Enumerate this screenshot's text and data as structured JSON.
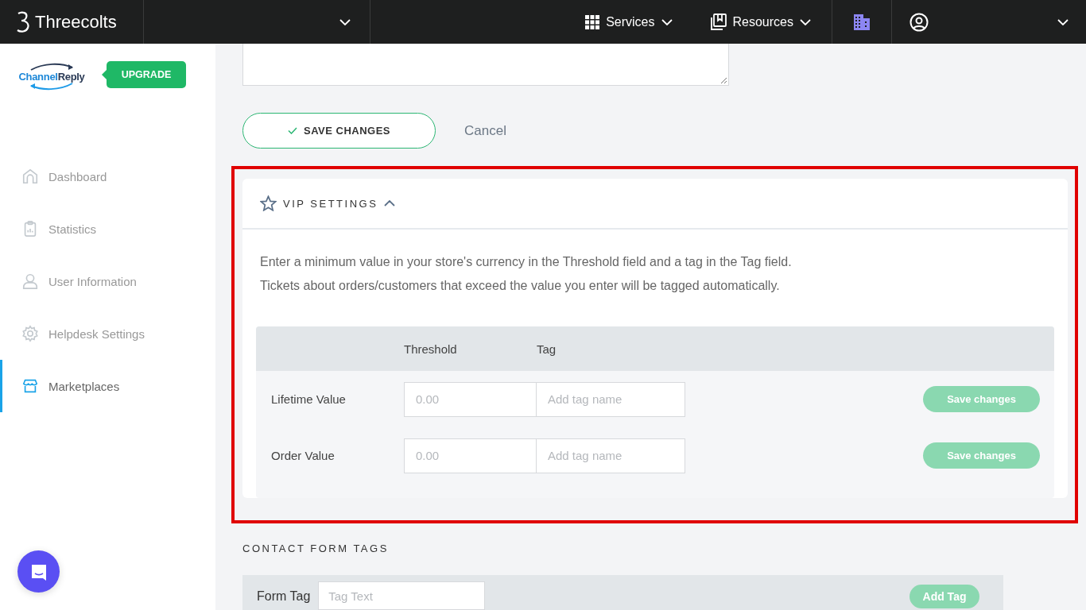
{
  "topbar": {
    "brand": "Threecolts",
    "menus": [
      {
        "label": "Services"
      },
      {
        "label": "Resources"
      }
    ]
  },
  "sidebar": {
    "logo": {
      "part_1": "Channel",
      "part_2": "Reply"
    },
    "upgrade": "UPGRADE",
    "items": [
      {
        "label": "Dashboard",
        "selected": false
      },
      {
        "label": "Statistics",
        "selected": false
      },
      {
        "label": "User Information",
        "selected": false
      },
      {
        "label": "Helpdesk Settings",
        "selected": false
      },
      {
        "label": "Marketplaces",
        "selected": true
      }
    ]
  },
  "form_actions": {
    "save": "SAVE CHANGES",
    "cancel": "Cancel"
  },
  "vip": {
    "title": "VIP SETTINGS",
    "expanded": true,
    "description": [
      "Enter a minimum value in your store's currency in the Threshold field and a tag in the Tag field.",
      "Tickets about orders/customers that exceed the value you enter will be tagged automatically."
    ],
    "columns": [
      "Threshold",
      "Tag"
    ],
    "rows": [
      {
        "label": "Lifetime Value",
        "threshold_placeholder": "0.00",
        "tag_placeholder": "Add tag name",
        "button": "Save changes",
        "disabled": true
      },
      {
        "label": "Order Value",
        "threshold_placeholder": "0.00",
        "tag_placeholder": "Add tag name",
        "button": "Save changes",
        "disabled": true
      }
    ]
  },
  "contact_form_tags": {
    "title": "CONTACT FORM TAGS",
    "label": "Form Tag",
    "placeholder": "Tag Text",
    "button": "Add Tag"
  }
}
